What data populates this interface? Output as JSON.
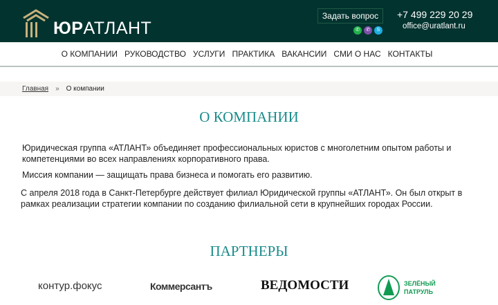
{
  "header": {
    "brand_bold": "ЮР",
    "brand_rest": "АТЛАНТ",
    "ask_button": "Задать вопрос",
    "phone": "+7 499 229 20 29",
    "email": "office@uratlant.ru",
    "messengers": [
      "whatsapp-icon",
      "viber-icon",
      "skype-icon"
    ],
    "bg_color": "#03332f"
  },
  "nav": {
    "items": [
      "О КОМПАНИИ",
      "РУКОВОДСТВО",
      "УСЛУГИ",
      "ПРАКТИКА",
      "ВАКАНСИИ",
      "СМИ О НАС",
      "КОНТАКТЫ"
    ]
  },
  "breadcrumb": {
    "home": "Главная",
    "sep": "»",
    "current": "О компании"
  },
  "main": {
    "title": "О КОМПАНИИ",
    "p1": "Юридическая группа «АТЛАНТ» объединяет профессиональных юристов с многолетним опытом работы и компетенциями во всех направлениях корпоративного права.",
    "p2": "Миссия компании — защищать права бизнеса и помогать его развитию.",
    "p3": "С апреля 2018 года в Санкт-Петербурге действует филиал Юридической группы «АТЛАНТ». Он был открыт в рамках реализации стратегии компании по созданию филиальной сети в крупнейших городах России.",
    "partners_title": "ПАРТНЕРЫ"
  },
  "partners": {
    "kontur": "контур.фокус",
    "kommersant": "Коммерсантъ",
    "vedomosti": "ВЕДОМОСТИ",
    "patrol_1": "ЗЕЛЁНЫЙ",
    "patrol_2": "ПАТРУЛЬ"
  },
  "accent": "#1a8b8b"
}
